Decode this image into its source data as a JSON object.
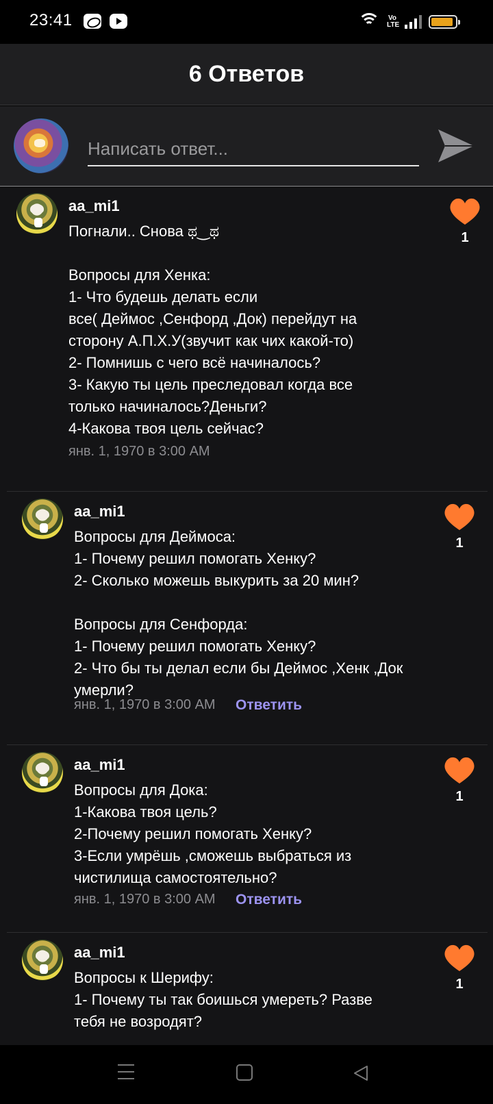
{
  "status_bar": {
    "time": "23:41",
    "icons": [
      "app-notification-icon",
      "youtube-icon",
      "wifi-icon",
      "volte-icon",
      "signal-icon",
      "battery-icon"
    ],
    "volte_label": "Vo LTE",
    "battery_level": 0.9,
    "battery_color": "#e8a21c"
  },
  "header": {
    "title": "6 Ответов"
  },
  "composer": {
    "placeholder": "Написать ответ..."
  },
  "colors": {
    "accent_like": "#ff7a2f",
    "reply_link": "#9c93f0",
    "background": "#141416"
  },
  "comments": [
    {
      "username": "aa_mi1",
      "text": "Погнали.. Снова ಥ‿ಥ\n\nВопросы для Хенка:\n1- Что будешь делать если\nвсе( Деймос ,Сенфорд ,Док) перейдут на\nсторону А.П.Х.У(звучит как чих какой-то)\n2- Помнишь с чего всё начиналось?\n3- Какую ты цель преследовал когда все\nтолько начиналось?Деньги?\n4-Какова твоя цель сейчас?",
      "date": "янв. 1, 1970 в 3:00 AM",
      "likes": "1"
    },
    {
      "username": "aa_mi1",
      "text": "Вопросы для Деймоса:\n1- Почему решил помогать Хенку?\n2- Сколько можешь выкурить за 20 мин?\n\nВопросы для Сенфорда:\n1- Почему решил помогать Хенку?\n2- Что бы ты делал если бы Деймос ,Хенк ,Док\nумерли?",
      "date": "янв. 1, 1970 в 3:00 AM",
      "reply_label": "Ответить",
      "likes": "1"
    },
    {
      "username": "aa_mi1",
      "text": "Вопросы для Дока:\n1-Какова твоя цель?\n2-Почему решил помогать Хенку?\n3-Если умрёшь ,сможешь выбраться из\nчистилища самостоятельно?",
      "date": "янв. 1, 1970 в 3:00 AM",
      "reply_label": "Ответить",
      "likes": "1"
    },
    {
      "username": "aa_mi1",
      "text": "Вопросы к Шерифу:\n1- Почему ты так боишься умереть? Разве\nтебя не возродят?",
      "likes": "1"
    }
  ]
}
